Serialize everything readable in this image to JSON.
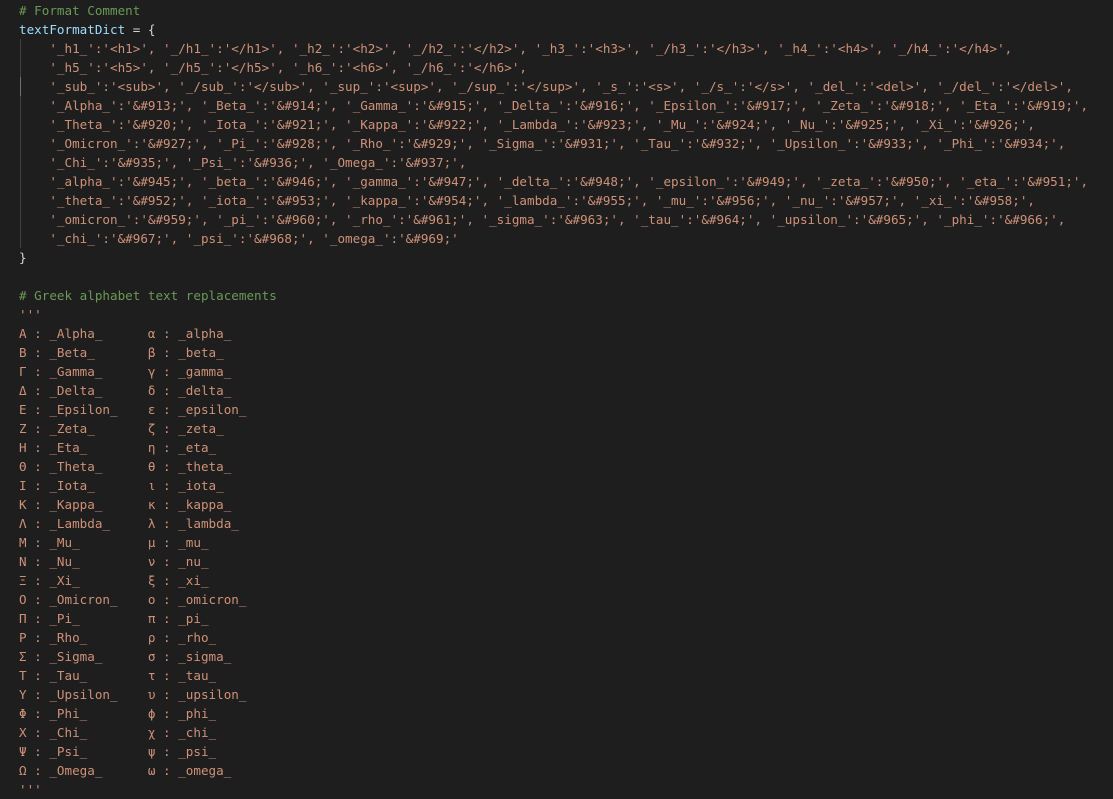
{
  "editor": {
    "lines": [
      [
        {
          "c": "cm",
          "t": "# Format Comment"
        }
      ],
      [
        {
          "c": "var",
          "t": "textFormatDict"
        },
        {
          "c": "punc",
          "t": " = {"
        }
      ],
      [
        {
          "c": "str",
          "t": "    '_h1_':'<h1>', '_/h1_':'</h1>', '_h2_':'<h2>', '_/h2_':'</h2>', '_h3_':'<h3>', '_/h3_':'</h3>', '_h4_':'<h4>', '_/h4_':'</h4>',"
        }
      ],
      [
        {
          "c": "str",
          "t": "    '_h5_':'<h5>', '_/h5_':'</h5>', '_h6_':'<h6>', '_/h6_':'</h6>',"
        }
      ],
      [
        {
          "c": "str",
          "t": "    '_sub_':'<sub>', '_/sub_':'</sub>', '_sup_':'<sup>', '_/sup_':'</sup>', '_s_':'<s>', '_/s_':'</s>', '_del_':'<del>', '_/del_':'</del>',"
        }
      ],
      [
        {
          "c": "str",
          "t": "    '_Alpha_':'&#913;', '_Beta_':'&#914;', '_Gamma_':'&#915;', '_Delta_':'&#916;', '_Epsilon_':'&#917;', '_Zeta_':'&#918;', '_Eta_':'&#919;',"
        }
      ],
      [
        {
          "c": "str",
          "t": "    '_Theta_':'&#920;', '_Iota_':'&#921;', '_Kappa_':'&#922;', '_Lambda_':'&#923;', '_Mu_':'&#924;', '_Nu_':'&#925;', '_Xi_':'&#926;',"
        }
      ],
      [
        {
          "c": "str",
          "t": "    '_Omicron_':'&#927;', '_Pi_':'&#928;', '_Rho_':'&#929;', '_Sigma_':'&#931;', '_Tau_':'&#932;', '_Upsilon_':'&#933;', '_Phi_':'&#934;',"
        }
      ],
      [
        {
          "c": "str",
          "t": "    '_Chi_':'&#935;', '_Psi_':'&#936;', '_Omega_':'&#937;',"
        }
      ],
      [
        {
          "c": "str",
          "t": "    '_alpha_':'&#945;', '_beta_':'&#946;', '_gamma_':'&#947;', '_delta_':'&#948;', '_epsilon_':'&#949;', '_zeta_':'&#950;', '_eta_':'&#951;',"
        }
      ],
      [
        {
          "c": "str",
          "t": "    '_theta_':'&#952;', '_iota_':'&#953;', '_kappa_':'&#954;', '_lambda_':'&#955;', '_mu_':'&#956;', '_nu_':'&#957;', '_xi_':'&#958;',"
        }
      ],
      [
        {
          "c": "str",
          "t": "    '_omicron_':'&#959;', '_pi_':'&#960;', '_rho_':'&#961;', '_sigma_':'&#963;', '_tau_':'&#964;', '_upsilon_':'&#965;', '_phi_':'&#966;',"
        }
      ],
      [
        {
          "c": "str",
          "t": "    '_chi_':'&#967;', '_psi_':'&#968;', '_omega_':'&#969;'"
        }
      ],
      [
        {
          "c": "punc",
          "t": "}"
        }
      ],
      [],
      [
        {
          "c": "cm",
          "t": "# Greek alphabet text replacements"
        }
      ],
      [
        {
          "c": "str",
          "t": "'''"
        }
      ],
      [
        {
          "c": "str",
          "t": "Α : _Alpha_      α : _alpha_"
        }
      ],
      [
        {
          "c": "str",
          "t": "Β : _Beta_       β : _beta_"
        }
      ],
      [
        {
          "c": "str",
          "t": "Γ : _Gamma_      γ : _gamma_"
        }
      ],
      [
        {
          "c": "str",
          "t": "Δ : _Delta_      δ : _delta_"
        }
      ],
      [
        {
          "c": "str",
          "t": "Ε : _Epsilon_    ε : _epsilon_"
        }
      ],
      [
        {
          "c": "str",
          "t": "Ζ : _Zeta_       ζ : _zeta_"
        }
      ],
      [
        {
          "c": "str",
          "t": "Η : _Eta_        η : _eta_"
        }
      ],
      [
        {
          "c": "str",
          "t": "Θ : _Theta_      θ : _theta_"
        }
      ],
      [
        {
          "c": "str",
          "t": "Ι : _Iota_       ι : _iota_"
        }
      ],
      [
        {
          "c": "str",
          "t": "Κ : _Kappa_      κ : _kappa_"
        }
      ],
      [
        {
          "c": "str",
          "t": "Λ : _Lambda_     λ : _lambda_"
        }
      ],
      [
        {
          "c": "str",
          "t": "Μ : _Mu_         μ : _mu_"
        }
      ],
      [
        {
          "c": "str",
          "t": "Ν : _Nu_         ν : _nu_"
        }
      ],
      [
        {
          "c": "str",
          "t": "Ξ : _Xi_         ξ : _xi_"
        }
      ],
      [
        {
          "c": "str",
          "t": "Ο : _Omicron_    ο : _omicron_"
        }
      ],
      [
        {
          "c": "str",
          "t": "Π : _Pi_         π : _pi_"
        }
      ],
      [
        {
          "c": "str",
          "t": "Ρ : _Rho_        ρ : _rho_"
        }
      ],
      [
        {
          "c": "str",
          "t": "Σ : _Sigma_      σ : _sigma_"
        }
      ],
      [
        {
          "c": "str",
          "t": "Τ : _Tau_        τ : _tau_"
        }
      ],
      [
        {
          "c": "str",
          "t": "Υ : _Upsilon_    υ : _upsilon_"
        }
      ],
      [
        {
          "c": "str",
          "t": "Φ : _Phi_        ϕ : _phi_"
        }
      ],
      [
        {
          "c": "str",
          "t": "Χ : _Chi_        χ : _chi_"
        }
      ],
      [
        {
          "c": "str",
          "t": "Ψ : _Psi_        ψ : _psi_"
        }
      ],
      [
        {
          "c": "str",
          "t": "Ω : _Omega_      ω : _omega_"
        }
      ],
      [
        {
          "c": "str",
          "t": "'''"
        }
      ]
    ]
  }
}
